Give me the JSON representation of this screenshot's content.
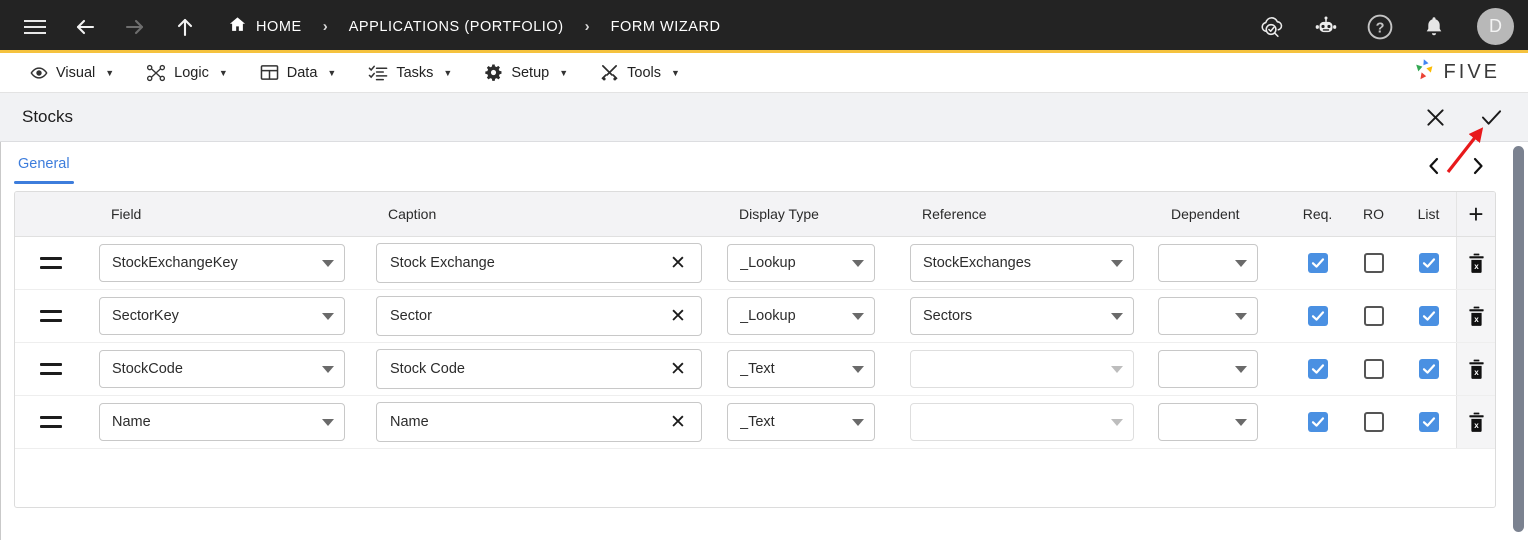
{
  "topbar": {
    "menu_icon": "hamburger-icon",
    "back_icon": "arrow-left-icon",
    "forward_icon": "arrow-right-icon",
    "up_icon": "arrow-up-icon",
    "breadcrumbs": [
      {
        "label": "HOME",
        "icon": "home-icon"
      },
      {
        "label": "APPLICATIONS (PORTFOLIO)",
        "icon": ""
      },
      {
        "label": "FORM WIZARD",
        "icon": ""
      }
    ],
    "separator": "›",
    "right_icons": [
      {
        "name": "cloud-check-icon"
      },
      {
        "name": "robot-chat-icon"
      },
      {
        "name": "help-icon"
      },
      {
        "name": "bell-icon"
      }
    ],
    "avatar_initial": "D",
    "bg_color": "#232323",
    "accent_color": "#f5c23e"
  },
  "menubar": {
    "items": [
      {
        "label": "Visual",
        "icon": "eye-icon",
        "caret": "▼"
      },
      {
        "label": "Logic",
        "icon": "logic-nodes-icon",
        "caret": "▼"
      },
      {
        "label": "Data",
        "icon": "table-grid-icon",
        "caret": "▼"
      },
      {
        "label": "Tasks",
        "icon": "checklist-icon",
        "caret": "▼"
      },
      {
        "label": "Setup",
        "icon": "gear-icon",
        "caret": "▼"
      },
      {
        "label": "Tools",
        "icon": "tools-icon",
        "caret": "▼"
      }
    ],
    "logo_text": "FIVE",
    "logo_icon": "five-pinwheel-logo"
  },
  "form_header": {
    "title": "Stocks",
    "close_label": "✕",
    "confirm_label": "✓"
  },
  "tabs": {
    "items": [
      {
        "label": "General",
        "active": true
      }
    ],
    "prev_icon": "chevron-left-icon",
    "next_icon": "chevron-right-icon",
    "accent_color": "#3d7ddc"
  },
  "grid": {
    "columns": [
      {
        "key": "handle",
        "label": ""
      },
      {
        "key": "field",
        "label": "Field"
      },
      {
        "key": "caption",
        "label": "Caption"
      },
      {
        "key": "display_type",
        "label": "Display Type"
      },
      {
        "key": "reference",
        "label": "Reference"
      },
      {
        "key": "dependent",
        "label": "Dependent"
      },
      {
        "key": "req",
        "label": "Req."
      },
      {
        "key": "ro",
        "label": "RO"
      },
      {
        "key": "list",
        "label": "List"
      },
      {
        "key": "add",
        "label": "+"
      }
    ],
    "add_label": "+",
    "clear_label": "✕",
    "delete_icon": "trash-delete-icon",
    "drag_icon": "drag-handle-icon",
    "rows": [
      {
        "field": "StockExchangeKey",
        "caption": "Stock Exchange",
        "display_type": "_Lookup",
        "reference": "StockExchanges",
        "reference_enabled": true,
        "dependent": "",
        "req": true,
        "ro": false,
        "list": true
      },
      {
        "field": "SectorKey",
        "caption": "Sector",
        "display_type": "_Lookup",
        "reference": "Sectors",
        "reference_enabled": true,
        "dependent": "",
        "req": true,
        "ro": false,
        "list": true
      },
      {
        "field": "StockCode",
        "caption": "Stock Code",
        "display_type": "_Text",
        "reference": "",
        "reference_enabled": false,
        "dependent": "",
        "req": true,
        "ro": false,
        "list": true
      },
      {
        "field": "Name",
        "caption": "Name",
        "display_type": "_Text",
        "reference": "",
        "reference_enabled": false,
        "dependent": "",
        "req": true,
        "ro": false,
        "list": true
      }
    ]
  },
  "annotation": {
    "arrow_color": "#e8191b",
    "points_to": "confirm-check-button"
  },
  "colors": {
    "checkbox_checked": "#4a90e2",
    "scrollbar": "#7b8290"
  }
}
